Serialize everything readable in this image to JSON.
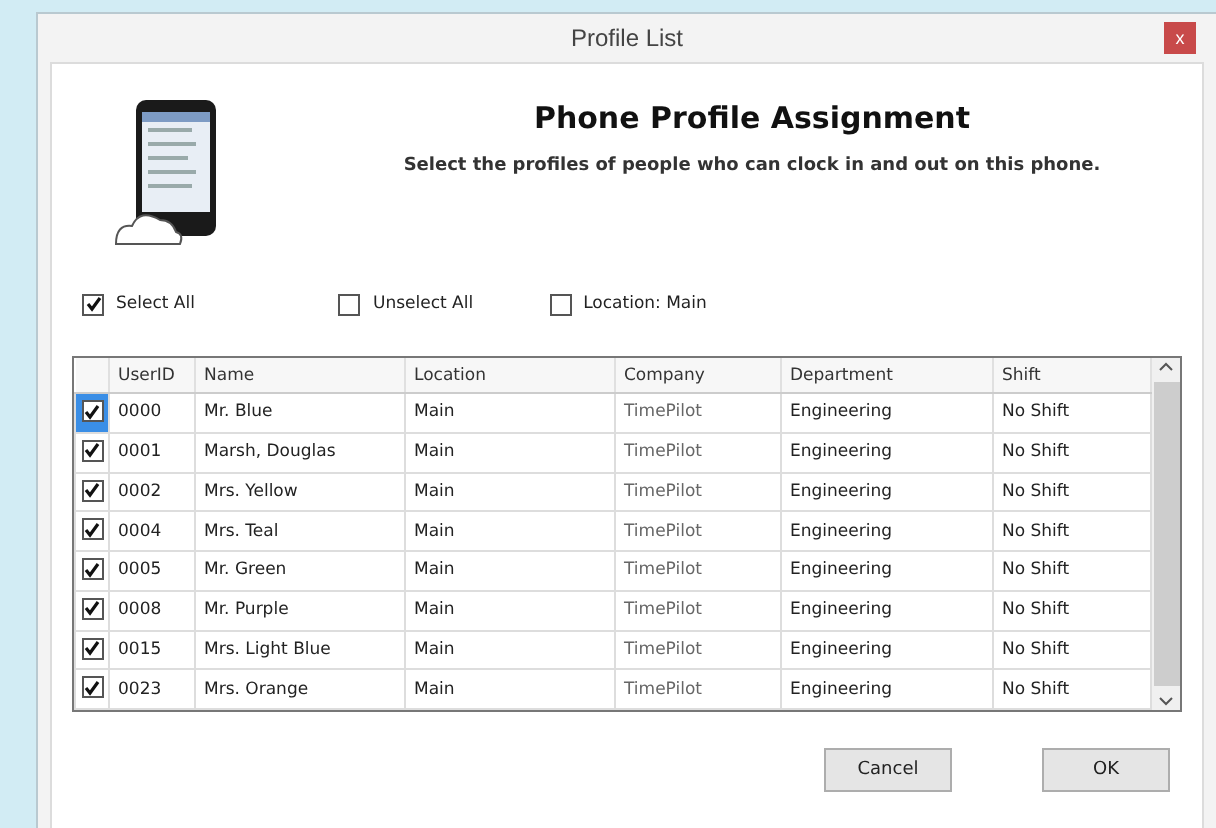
{
  "window": {
    "title": "Profile List",
    "close": "x"
  },
  "header": {
    "title": "Phone Profile Assignment",
    "subtitle": "Select the profiles of people who can clock in and out on this phone."
  },
  "options": [
    {
      "label": "Select All",
      "checked": true
    },
    {
      "label": "Unselect All",
      "checked": false
    },
    {
      "label": "Location: Main",
      "checked": false
    }
  ],
  "table": {
    "columns": [
      "UserID",
      "Name",
      "Location",
      "Company",
      "Department",
      "Shift"
    ],
    "rows": [
      {
        "checked": true,
        "selected": true,
        "cells": [
          "0000",
          "Mr. Blue",
          "Main",
          "TimePilot",
          "Engineering",
          "No Shift"
        ]
      },
      {
        "checked": true,
        "selected": false,
        "cells": [
          "0001",
          "Marsh, Douglas",
          "Main",
          "TimePilot",
          "Engineering",
          "No Shift"
        ]
      },
      {
        "checked": true,
        "selected": false,
        "cells": [
          "0002",
          "Mrs. Yellow",
          "Main",
          "TimePilot",
          "Engineering",
          "No Shift"
        ]
      },
      {
        "checked": true,
        "selected": false,
        "cells": [
          "0004",
          "Mrs. Teal",
          "Main",
          "TimePilot",
          "Engineering",
          "No Shift"
        ]
      },
      {
        "checked": true,
        "selected": false,
        "cells": [
          "0005",
          "Mr. Green",
          "Main",
          "TimePilot",
          "Engineering",
          "No Shift"
        ]
      },
      {
        "checked": true,
        "selected": false,
        "cells": [
          "0008",
          "Mr. Purple",
          "Main",
          "TimePilot",
          "Engineering",
          "No Shift"
        ]
      },
      {
        "checked": true,
        "selected": false,
        "cells": [
          "0015",
          "Mrs. Light Blue",
          "Main",
          "TimePilot",
          "Engineering",
          "No Shift"
        ]
      },
      {
        "checked": true,
        "selected": false,
        "cells": [
          "0023",
          "Mrs. Orange",
          "Main",
          "TimePilot",
          "Engineering",
          "No Shift"
        ]
      }
    ]
  },
  "buttons": [
    "Cancel",
    "OK"
  ]
}
